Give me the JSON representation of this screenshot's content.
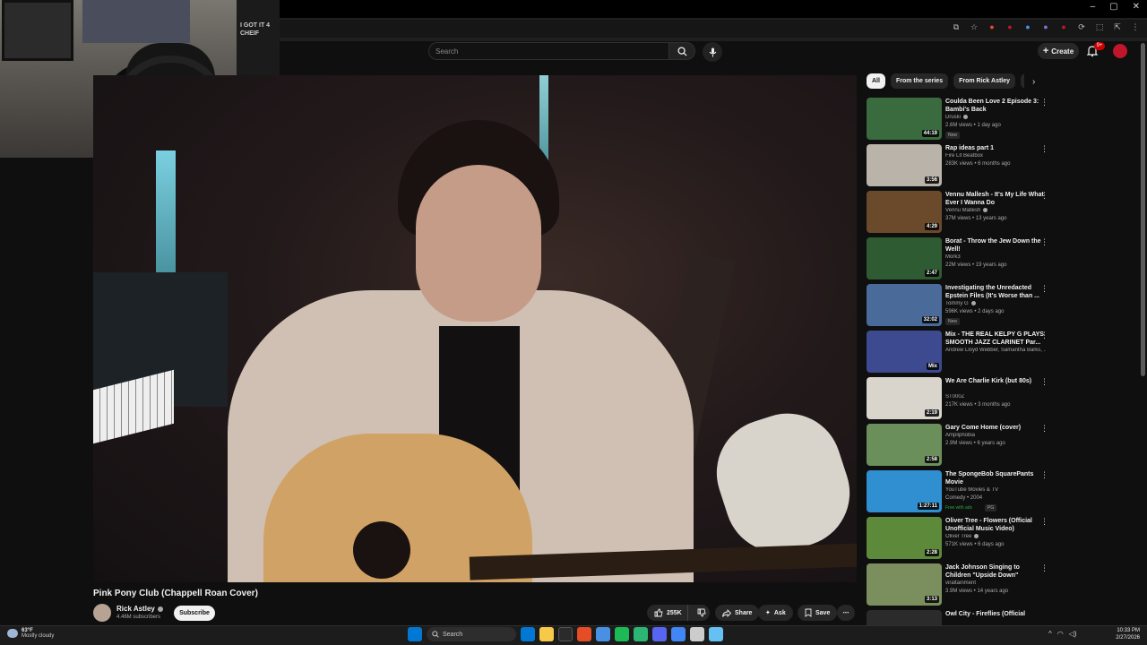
{
  "browser": {
    "window_controls": [
      "–",
      "▢",
      "✕"
    ],
    "extension_icons": [
      "⧉",
      "☆",
      "●",
      "●",
      "●",
      "●",
      "●",
      "⟳",
      "⬚",
      "⇱",
      "⋮"
    ]
  },
  "webcam": {
    "shirt_text": "I GOT IT 4 CHEIF"
  },
  "header": {
    "search_placeholder": "Search",
    "create_label": "Create",
    "notification_count": "9+"
  },
  "video": {
    "title": "Pink Pony Club (Chappell Roan Cover)",
    "channel": "Rick Astley",
    "subscribers": "4.46M subscribers",
    "subscribe_label": "Subscribe",
    "likes": "255K",
    "share_label": "Share",
    "ask_label": "Ask",
    "save_label": "Save"
  },
  "chips": [
    "All",
    "From the series",
    "From Rick Astley",
    "Ch"
  ],
  "recommendations": [
    {
      "title": "Coulda Been Love 2 Episode 3: Bambi's Back",
      "channel": "Druski",
      "verified": true,
      "meta": "2.6M views • 1 day ago",
      "badge": "New",
      "duration": "44:19",
      "color": "#3a6b3f"
    },
    {
      "title": "Rap ideas part 1",
      "channel": "Fire Lit Beatbox",
      "verified": false,
      "meta": "283K views • 6 months ago",
      "badge": "",
      "duration": "3:56",
      "color": "#b9b3aa"
    },
    {
      "title": "Vennu Mallesh - It's My Life What Ever I Wanna Do",
      "channel": "Vennu Mallesh",
      "verified": true,
      "meta": "37M views • 13 years ago",
      "badge": "",
      "duration": "4:29",
      "color": "#6b4a2c"
    },
    {
      "title": "Borat - Throw the Jew Down the Well!",
      "channel": "Mork3",
      "verified": false,
      "meta": "22M views • 19 years ago",
      "badge": "",
      "duration": "2:47",
      "color": "#2f5b33"
    },
    {
      "title": "Investigating the Unredacted Epstein Files (It's Worse than ...",
      "channel": "Tommy G",
      "verified": true,
      "meta": "596K views • 2 days ago",
      "badge": "New",
      "duration": "32:02",
      "color": "#4a6b9a"
    },
    {
      "title": "Mix - THE REAL KELPY G PLAYS SMOOTH JAZZ CLARINET Par...",
      "channel": "Andrew Lloyd Webber, Samantha Barks, ...",
      "verified": false,
      "meta": "",
      "badge": "",
      "duration": "Mix",
      "color": "#3d4a8f"
    },
    {
      "title": "We Are Charlie Kirk (but 80s)",
      "channel": "ST000Z",
      "verified": false,
      "meta": "217K views • 3 months ago",
      "badge": "",
      "duration": "2:19",
      "color": "#d9d4cc"
    },
    {
      "title": "Gary Come Home (cover)",
      "channel": "Ampliphobia",
      "verified": false,
      "meta": "2.9M views • 6 years ago",
      "badge": "",
      "duration": "2:58",
      "color": "#6b8f5a"
    },
    {
      "title": "The SpongeBob SquarePants Movie",
      "channel": "YouTube Movies & TV",
      "verified": false,
      "meta": "Comedy • 2004",
      "badge": "Free with ads",
      "badge2": "PG",
      "duration": "1:27:11",
      "color": "#2f8fd0"
    },
    {
      "title": "Oliver Tree - Flowers (Official Unofficial Music Video)",
      "channel": "Oliver Tree",
      "verified": true,
      "meta": "571K views • 6 days ago",
      "badge": "",
      "duration": "2:28",
      "color": "#5d8a3a"
    },
    {
      "title": "Jack Johnson Singing to Children \"Upside Down\"",
      "channel": "viraltainment",
      "verified": false,
      "meta": "3.9M views • 14 years ago",
      "badge": "",
      "duration": "3:13",
      "color": "#7a8f5d"
    },
    {
      "title": "Owl City - Fireflies (Official",
      "channel": "",
      "verified": false,
      "meta": "",
      "badge": "",
      "duration": "",
      "color": "#2b2b2b"
    }
  ],
  "taskbar": {
    "temperature": "63°F",
    "weather": "Mostly cloudy",
    "search_label": "Search",
    "time": "10:33 PM",
    "date": "2/27/2026",
    "app_colors": [
      "#0078d4",
      "#f7c948",
      "#2b2b2b",
      "#e44d26",
      "#4a90e2",
      "#1db954",
      "#2bb673",
      "#5865f2",
      "#4285f4",
      "#cccccc",
      "#66c0f4"
    ]
  }
}
